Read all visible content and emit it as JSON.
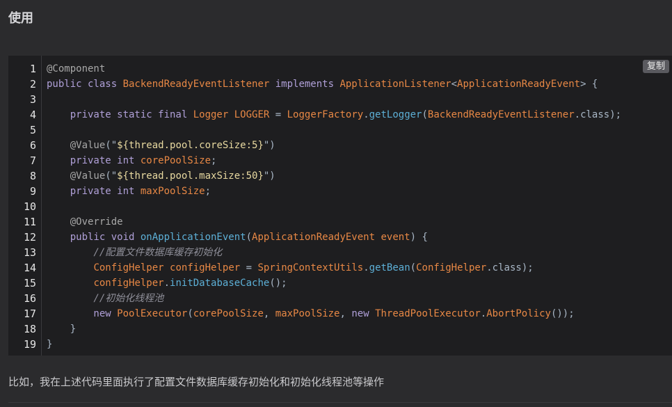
{
  "heading": "使用",
  "code_block": {
    "copy_label": "复制",
    "line_numbers": [
      "1",
      "2",
      "3",
      "4",
      "5",
      "6",
      "7",
      "8",
      "9",
      "10",
      "11",
      "12",
      "13",
      "14",
      "15",
      "16",
      "17",
      "18",
      "19"
    ],
    "lines": [
      [
        {
          "t": "@Component",
          "c": "ann2"
        }
      ],
      [
        {
          "t": "public class ",
          "c": "kw2"
        },
        {
          "t": "BackendReadyEventListener",
          "c": "type"
        },
        {
          "t": " implements ",
          "c": "kw2"
        },
        {
          "t": "ApplicationListener",
          "c": "type"
        },
        {
          "t": "<",
          "c": "plain"
        },
        {
          "t": "ApplicationReadyEvent",
          "c": "type"
        },
        {
          "t": "> {",
          "c": "plain"
        }
      ],
      [],
      [
        {
          "t": "    private static final ",
          "c": "kw2"
        },
        {
          "t": "Logger",
          "c": "type"
        },
        {
          "t": " ",
          "c": "plain"
        },
        {
          "t": "LOGGER",
          "c": "type"
        },
        {
          "t": " = ",
          "c": "plain"
        },
        {
          "t": "LoggerFactory",
          "c": "type"
        },
        {
          "t": ".",
          "c": "plain"
        },
        {
          "t": "getLogger",
          "c": "method"
        },
        {
          "t": "(",
          "c": "plain"
        },
        {
          "t": "BackendReadyEventListener",
          "c": "type"
        },
        {
          "t": ".class);",
          "c": "plain"
        }
      ],
      [],
      [
        {
          "t": "    @Value",
          "c": "ann2"
        },
        {
          "t": "(\"",
          "c": "plain"
        },
        {
          "t": "${thread.pool.coreSize:5}",
          "c": "str"
        },
        {
          "t": "\")",
          "c": "plain"
        }
      ],
      [
        {
          "t": "    private int ",
          "c": "kw2"
        },
        {
          "t": "corePoolSize",
          "c": "field"
        },
        {
          "t": ";",
          "c": "plain"
        }
      ],
      [
        {
          "t": "    @Value",
          "c": "ann2"
        },
        {
          "t": "(\"",
          "c": "plain"
        },
        {
          "t": "${thread.pool.maxSize:50}",
          "c": "str"
        },
        {
          "t": "\")",
          "c": "plain"
        }
      ],
      [
        {
          "t": "    private int ",
          "c": "kw2"
        },
        {
          "t": "maxPoolSize",
          "c": "field"
        },
        {
          "t": ";",
          "c": "plain"
        }
      ],
      [],
      [
        {
          "t": "    @Override",
          "c": "ann2"
        }
      ],
      [
        {
          "t": "    public void ",
          "c": "kw2"
        },
        {
          "t": "onApplicationEvent",
          "c": "method"
        },
        {
          "t": "(",
          "c": "plain"
        },
        {
          "t": "ApplicationReadyEvent",
          "c": "type"
        },
        {
          "t": " ",
          "c": "plain"
        },
        {
          "t": "event",
          "c": "field"
        },
        {
          "t": ") {",
          "c": "plain"
        }
      ],
      [
        {
          "t": "        //配置文件数据库缓存初始化",
          "c": "comment"
        }
      ],
      [
        {
          "t": "        ",
          "c": "plain"
        },
        {
          "t": "ConfigHelper",
          "c": "type"
        },
        {
          "t": " ",
          "c": "plain"
        },
        {
          "t": "configHelper",
          "c": "field"
        },
        {
          "t": " = ",
          "c": "plain"
        },
        {
          "t": "SpringContextUtils",
          "c": "type"
        },
        {
          "t": ".",
          "c": "plain"
        },
        {
          "t": "getBean",
          "c": "method"
        },
        {
          "t": "(",
          "c": "plain"
        },
        {
          "t": "ConfigHelper",
          "c": "type"
        },
        {
          "t": ".class);",
          "c": "plain"
        }
      ],
      [
        {
          "t": "        ",
          "c": "plain"
        },
        {
          "t": "configHelper",
          "c": "field"
        },
        {
          "t": ".",
          "c": "plain"
        },
        {
          "t": "initDatabaseCache",
          "c": "method"
        },
        {
          "t": "();",
          "c": "plain"
        }
      ],
      [
        {
          "t": "        //初始化线程池",
          "c": "comment"
        }
      ],
      [
        {
          "t": "        new ",
          "c": "kw2"
        },
        {
          "t": "PoolExecutor",
          "c": "type"
        },
        {
          "t": "(",
          "c": "plain"
        },
        {
          "t": "corePoolSize",
          "c": "field"
        },
        {
          "t": ", ",
          "c": "plain"
        },
        {
          "t": "maxPoolSize",
          "c": "field"
        },
        {
          "t": ", ",
          "c": "plain"
        },
        {
          "t": "new ",
          "c": "kw2"
        },
        {
          "t": "ThreadPoolExecutor",
          "c": "type"
        },
        {
          "t": ".",
          "c": "plain"
        },
        {
          "t": "AbortPolicy",
          "c": "type"
        },
        {
          "t": "());",
          "c": "plain"
        }
      ],
      [
        {
          "t": "    }",
          "c": "plain"
        }
      ],
      [
        {
          "t": "}",
          "c": "plain"
        }
      ]
    ]
  },
  "paragraph": "比如，我在上述代码里面执行了配置文件数据库缓存初始化和初始化线程池等操作",
  "colors": {
    "background": "#2b2b2d",
    "code_background": "#1e1e20",
    "keyword": "#b0a0d8",
    "type": "#e88845",
    "string": "#e8d9a0",
    "method": "#5db0d7",
    "comment": "#8f8f99"
  }
}
